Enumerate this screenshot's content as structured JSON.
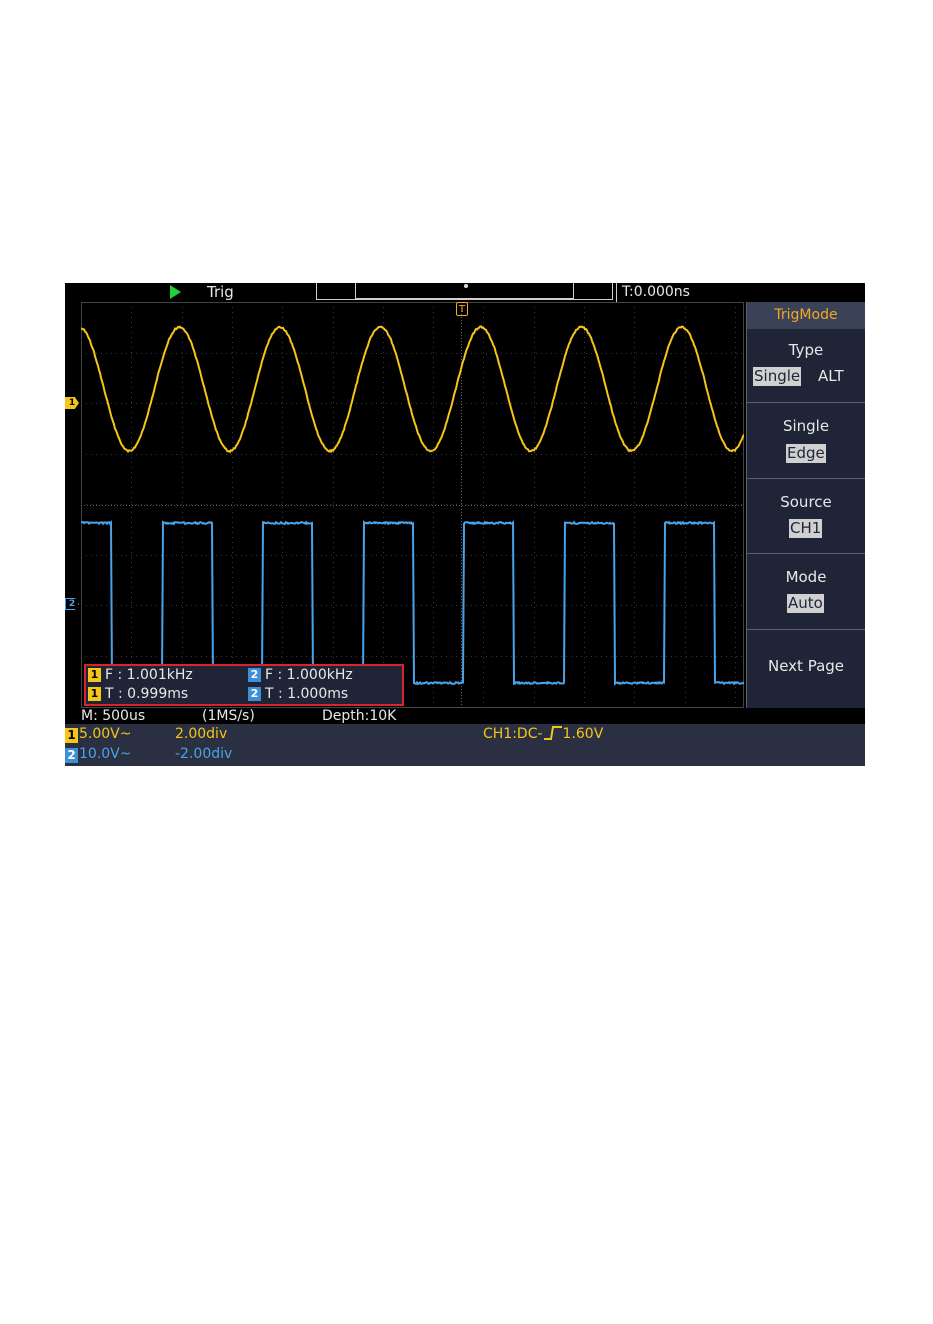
{
  "status": {
    "run_state": "Trig",
    "time_offset": "T:0.000ns"
  },
  "channels": {
    "ch1": {
      "marker": "1",
      "color": "#f5c518",
      "volts_div": "5.00V~",
      "position": "2.00div"
    },
    "ch2": {
      "marker": "2",
      "color": "#4aa3e8",
      "volts_div": "10.0V~",
      "position": "-2.00div"
    }
  },
  "trigger_marker": "T",
  "measurements": {
    "ch1_freq": {
      "badge": "1",
      "text": "F : 1.001kHz"
    },
    "ch2_freq": {
      "badge": "2",
      "text": "F : 1.000kHz"
    },
    "ch1_period": {
      "badge": "1",
      "text": "T : 0.999ms"
    },
    "ch2_period": {
      "badge": "2",
      "text": "T : 1.000ms"
    }
  },
  "menu": {
    "title": "TrigMode",
    "type": {
      "label": "Type",
      "options": [
        "Single",
        "ALT"
      ],
      "selected": "Single"
    },
    "single": {
      "label": "Single",
      "value": "Edge"
    },
    "source": {
      "label": "Source",
      "value": "CH1"
    },
    "mode": {
      "label": "Mode",
      "value": "Auto"
    },
    "next_page": "Next Page"
  },
  "acquisition": {
    "timebase": "M: 500us",
    "sample_rate": "(1MS/s)",
    "depth": "Depth:10K"
  },
  "trigger_info": {
    "coupling": "CH1:DC-",
    "level": "1.60V"
  },
  "waveforms": {
    "ch1": {
      "shape": "sine",
      "cycles_on_screen": 6.6,
      "color": "#f5c518"
    },
    "ch2": {
      "shape": "square",
      "cycles_on_screen": 6.6,
      "color": "#4aa3e8"
    }
  }
}
